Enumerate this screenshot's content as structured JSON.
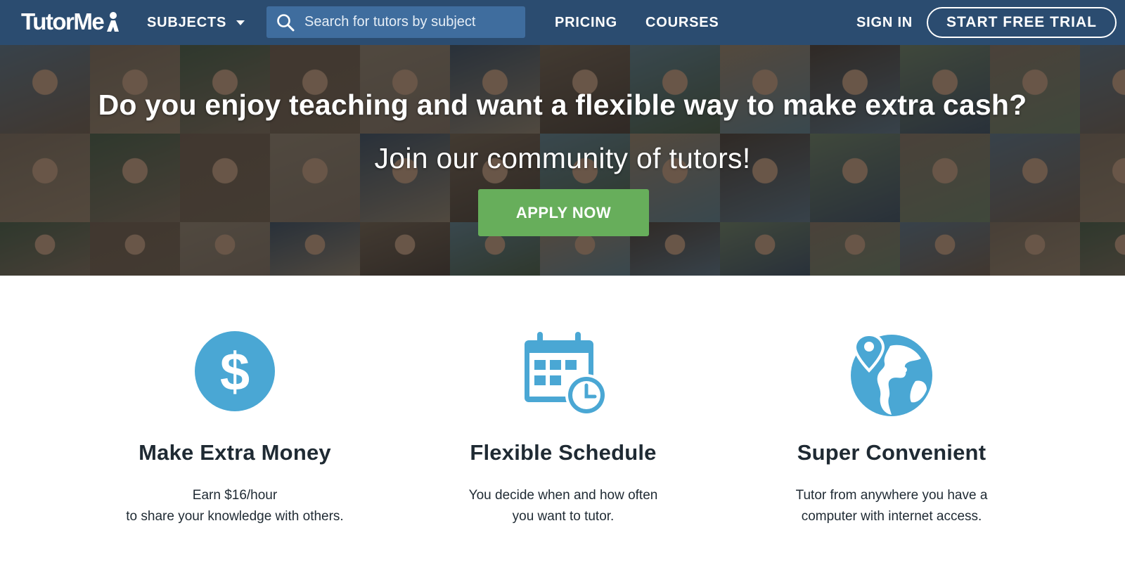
{
  "nav": {
    "logo_text": "TutorMe",
    "subjects_label": "SUBJECTS",
    "search_placeholder": "Search for tutors by subject",
    "pricing_label": "PRICING",
    "courses_label": "COURSES",
    "signin_label": "SIGN IN",
    "trial_label": "START FREE TRIAL"
  },
  "hero": {
    "title": "Do you enjoy teaching and want a flexible way to make extra cash?",
    "subtitle": "Join our community of tutors!",
    "cta_label": "APPLY NOW"
  },
  "features": [
    {
      "icon": "dollar-icon",
      "title": "Make Extra Money",
      "desc_line1": "Earn $16/hour",
      "desc_line2": "to share your knowledge with others."
    },
    {
      "icon": "calendar-clock-icon",
      "title": "Flexible Schedule",
      "desc_line1": "You decide when and how often",
      "desc_line2": "you want to tutor."
    },
    {
      "icon": "globe-pin-icon",
      "title": "Super Convenient",
      "desc_line1": "Tutor from anywhere you have a",
      "desc_line2": "computer with internet access."
    }
  ],
  "colors": {
    "navbar": "#2b4c70",
    "search_bg": "#3f6d9e",
    "cta_green": "#67ae5b",
    "icon_blue": "#4aa7d4",
    "text_dark": "#1f2a33"
  }
}
